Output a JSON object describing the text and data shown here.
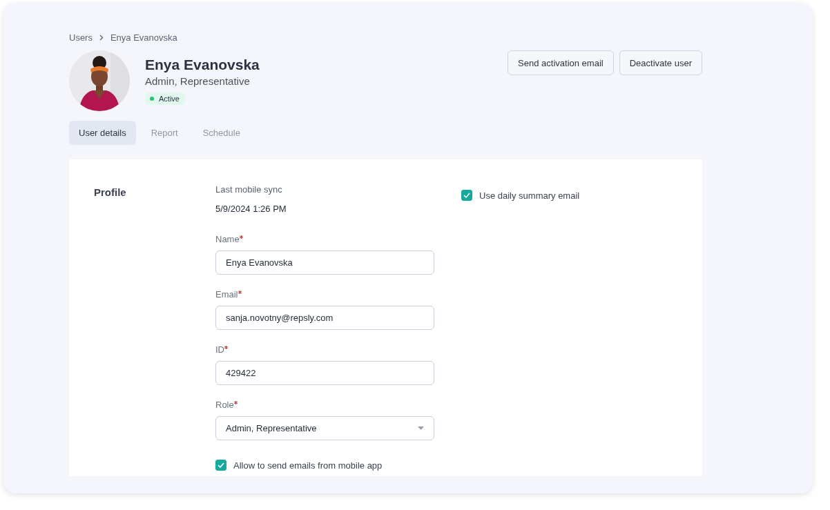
{
  "breadcrumb": [
    {
      "label": "Users"
    },
    {
      "label": "Enya Evanovska"
    }
  ],
  "user": {
    "name": "Enya Evanovska",
    "roles": "Admin, Representative",
    "status": "Active"
  },
  "actions": [
    "Send activation email",
    "Deactivate user"
  ],
  "tabs": [
    {
      "label": "User details",
      "selected": true
    },
    {
      "label": "Report",
      "selected": false
    },
    {
      "label": "Schedule",
      "selected": false
    }
  ],
  "profile": {
    "heading": "Profile",
    "last_sync": {
      "label": "Last mobile sync",
      "value": "5/9/2024 1:26 PM"
    },
    "fields": [
      {
        "kind": "text",
        "label": "Name",
        "required": true,
        "value": "Enya Evanovska"
      },
      {
        "kind": "text",
        "label": "Email",
        "required": true,
        "value": "sanja.novotny@repsly.com"
      },
      {
        "kind": "text",
        "label": "ID",
        "required": true,
        "value": "429422"
      },
      {
        "kind": "select",
        "label": "Role",
        "required": true,
        "value": "Admin, Representative"
      }
    ],
    "checkboxes": [
      {
        "label": "Allow to send emails from mobile app",
        "checked": true
      }
    ],
    "side_options": [
      {
        "label": "Use daily summary email",
        "checked": true
      }
    ]
  }
}
